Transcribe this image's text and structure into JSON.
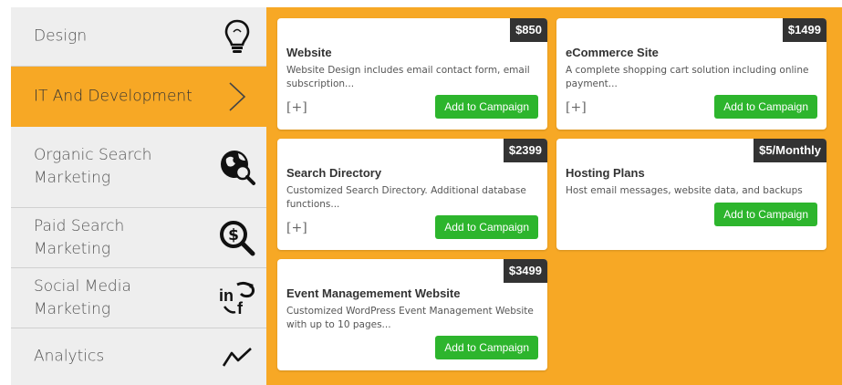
{
  "sidebar": {
    "items": [
      {
        "label": "Design",
        "icon": "lightbulb-icon"
      },
      {
        "label": "IT And Development",
        "icon": "chevron-right-icon",
        "active": true
      },
      {
        "label": "Organic Search Marketing",
        "icon": "globe-search-icon"
      },
      {
        "label": "Paid Search Marketing",
        "icon": "dollar-search-icon"
      },
      {
        "label": "Social Media Marketing",
        "icon": "social-media-icon"
      },
      {
        "label": "Analytics",
        "icon": "line-chart-icon"
      }
    ]
  },
  "colors": {
    "accent": "#f7a825",
    "button": "#2db52d",
    "price_badge": "#333333",
    "sidebar_bg": "#eeeeee"
  },
  "cards": [
    {
      "price": "$850",
      "title": "Website",
      "description": "Website Design includes email contact form, email subscription...",
      "expand": "[+]",
      "button": "Add to Campaign"
    },
    {
      "price": "$1499",
      "title": "eCommerce Site",
      "description": "A complete shopping cart solution including online payment...",
      "expand": "[+]",
      "button": "Add to Campaign"
    },
    {
      "price": "$2399",
      "title": "Search Directory",
      "description": "Customized Search Directory. Additional database functions...",
      "expand": "[+]",
      "button": "Add to Campaign"
    },
    {
      "price": "$5/Monthly",
      "title": "Hosting Plans",
      "description": "Host email messages, website data, and backups",
      "button": "Add to Campaign"
    },
    {
      "price": "$3499",
      "title": "Event Managemement Website",
      "description": "Customized WordPress Event Management Website with up to 10 pages...",
      "button": "Add to Campaign"
    }
  ]
}
